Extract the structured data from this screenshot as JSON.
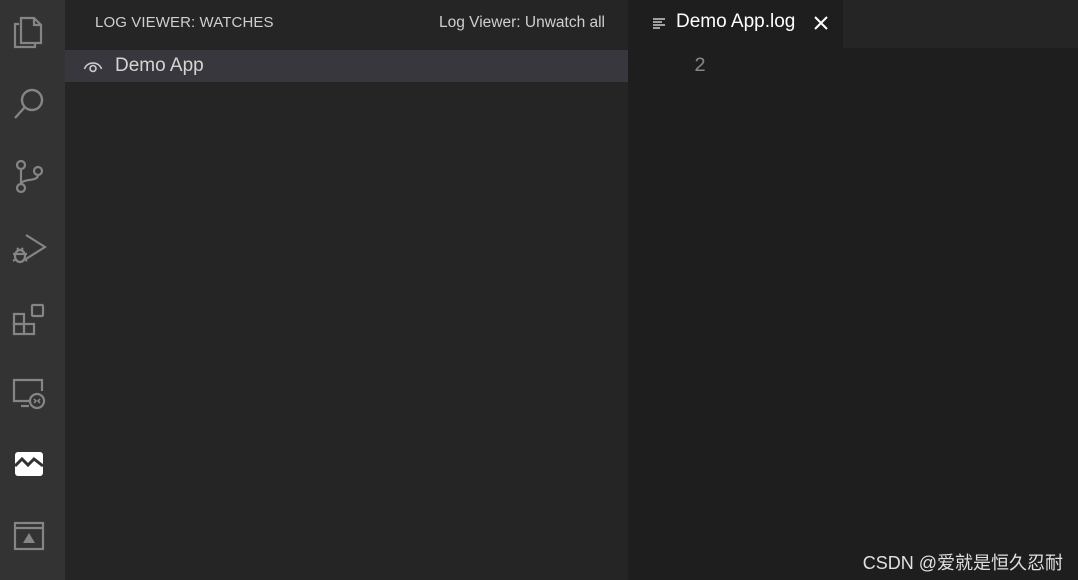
{
  "activity_bar": {
    "icons": [
      "files-icon",
      "search-icon",
      "source-control-icon",
      "run-debug-icon",
      "extensions-icon",
      "remote-explorer-icon",
      "log-viewer-icon",
      "panel-icon"
    ],
    "active_icon": "log-viewer-icon"
  },
  "sidebar": {
    "title": "LOG VIEWER: WATCHES",
    "action": "Log Viewer: Unwatch all",
    "items": [
      {
        "label": "Demo App",
        "icon": "eye-watch-icon"
      }
    ]
  },
  "editor": {
    "tab": {
      "title": "Demo App.log",
      "icon": "file-lines-icon",
      "close_icon": "close-icon"
    },
    "line_numbers": [
      "2"
    ]
  },
  "watermark": "CSDN @爱就是恒久忍耐",
  "colors": {
    "activity_bar_bg": "#333333",
    "sidebar_bg": "#252526",
    "editor_bg": "#1e1e1e",
    "selected_item_bg": "#37373d"
  }
}
